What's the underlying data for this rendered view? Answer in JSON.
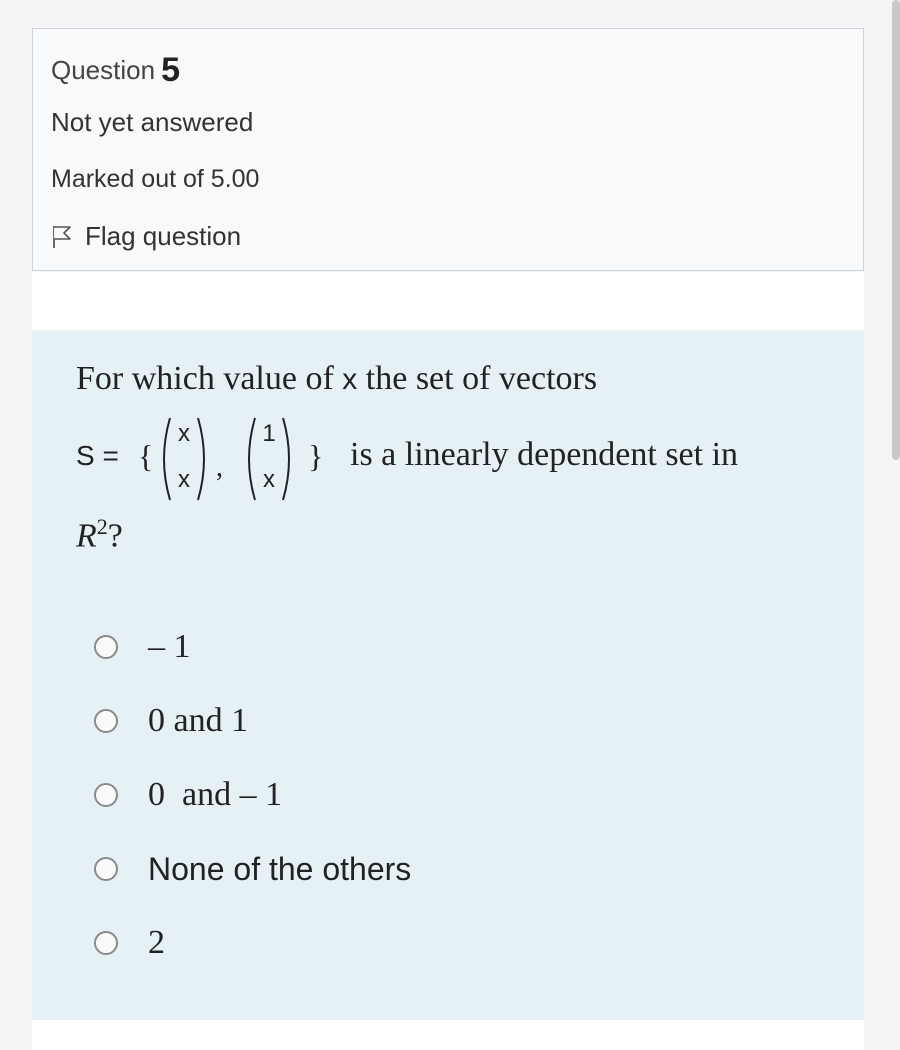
{
  "info": {
    "question_word": "Question",
    "question_number": "5",
    "status": "Not yet answered",
    "marks": "Marked out of 5.00",
    "flag_label": "Flag question",
    "flag_icon": "flag-icon"
  },
  "question": {
    "text_before": "For which value of ",
    "text_var": "x",
    "text_after": " the set of vectors",
    "set_lhs": "S =",
    "brace_open": "{",
    "brace_close": "}",
    "vector1": {
      "top": "x",
      "bottom": "x"
    },
    "comma": ",",
    "vector2": {
      "top": "1",
      "bottom": "x"
    },
    "tail_text": "is a linearly dependent set in",
    "space_letter": "R",
    "space_exp": "2",
    "space_suffix": "?"
  },
  "options": [
    {
      "label": "– 1"
    },
    {
      "label": "0 and 1"
    },
    {
      "label": "0  and – 1"
    },
    {
      "label": "None of the others"
    },
    {
      "label": "2"
    }
  ],
  "colors": {
    "background": "#f4f4f4",
    "info_bg": "#f8f9fa",
    "question_bg": "#e6f1f5",
    "border": "#cfd5de"
  }
}
